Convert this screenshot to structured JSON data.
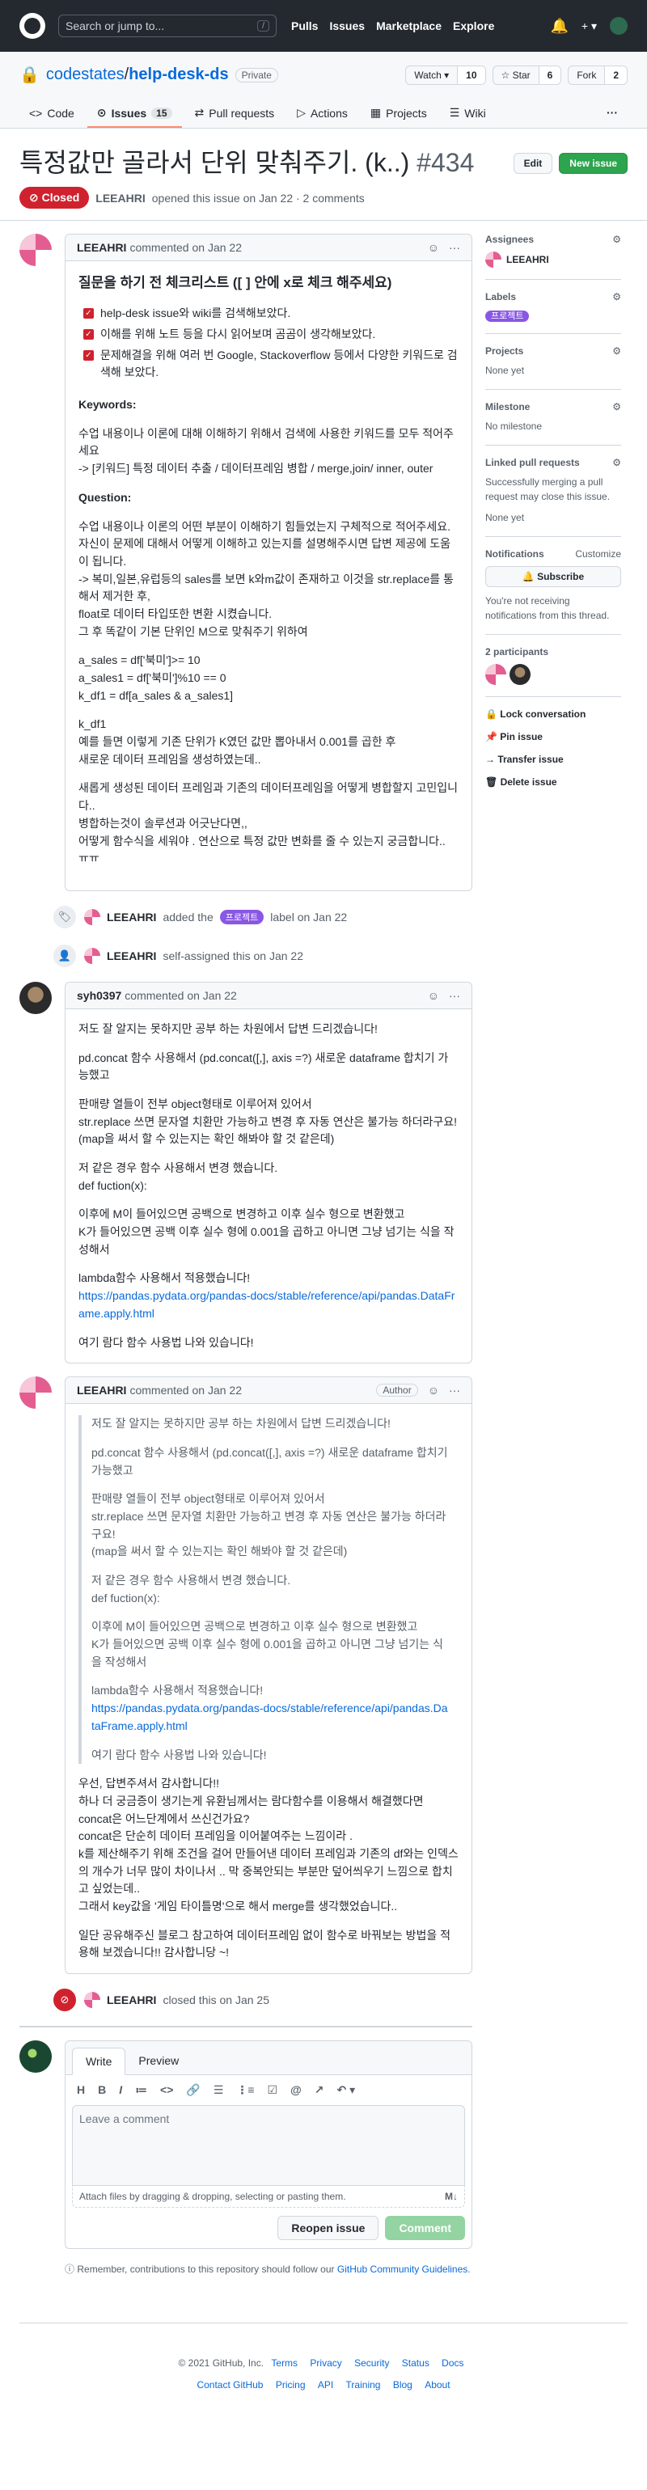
{
  "header": {
    "search_placeholder": "Search or jump to...",
    "search_key": "/",
    "nav": [
      "Pulls",
      "Issues",
      "Marketplace",
      "Explore"
    ],
    "bell": "🔔",
    "plus": "+ ▾"
  },
  "repo": {
    "owner": "codestates",
    "sep": " / ",
    "name": "help-desk-ds",
    "visibility": "Private",
    "watch_label": "Watch ▾",
    "watch_count": "10",
    "star_label": "☆ Star",
    "star_count": "6",
    "fork_label": "Fork",
    "fork_count": "2"
  },
  "tabs": [
    {
      "icon": "<>",
      "label": "Code"
    },
    {
      "icon": "⊙",
      "label": "Issues",
      "count": "15"
    },
    {
      "icon": "⇄",
      "label": "Pull requests"
    },
    {
      "icon": "▷",
      "label": "Actions"
    },
    {
      "icon": "▦",
      "label": "Projects"
    },
    {
      "icon": "☰",
      "label": "Wiki"
    }
  ],
  "tab_more": "···",
  "issue": {
    "title": "특정값만 골라서 단위 맞춰주기. (k..)",
    "number": "#434",
    "edit_label": "Edit",
    "new_label": "New issue",
    "state": "⊘ Closed",
    "author": "LEEAHRI",
    "meta": "opened this issue on Jan 22 · 2 comments"
  },
  "comments": [
    {
      "author": "LEEAHRI",
      "date": "commented on Jan 22",
      "heading": "질문을 하기 전 체크리스트 ([ ] 안에 x로 체크 해주세요)",
      "checks": [
        "help-desk issue와 wiki를 검색해보았다.",
        "이해를 위해 노트 등을 다시 읽어보며 곰곰이 생각해보았다.",
        "문제해결을 위해 여러 번 Google, Stackoverflow 등에서 다양한 키워드로 검색해 보았다."
      ],
      "kw_title": "Keywords:",
      "kw_text": "수업 내용이나 이론에 대해 이해하기 위해서 검색에 사용한 키워드를 모두 적어주세요\n-> [키워드] 특정 데이터 추출 / 데이터프레임 병합 / merge,join/ inner, outer",
      "q_title": "Question:",
      "q_p1": "수업 내용이나 이론의 어떤 부분이 이해하기 힘들었는지 구체적으로 적어주세요. 자신이 문제에 대해서 어떻게 이해하고 있는지를 설명해주시면 답변 제공에 도움이 됩니다.\n-> 복미,일본,유럽등의 sales를 보면 k와m값이 존재하고 이것을 str.replace를 통해서 제거한 후,\nfloat로 데이터 타입또한 변환 시켰습니다.\n그 후 똑같이 기본 단위인 M으로 맞춰주기 위하여",
      "q_p2": "a_sales = df['북미']>= 10\na_sales1 = df['북미']%10 == 0\nk_df1 = df[a_sales & a_sales1]",
      "q_p3": "k_df1\n예를 들면 이렇게 기존 단위가 K였던 값만 뽑아내서 0.001를 곱한 후\n새로운 데이터 프레임을 생성하였는데..",
      "q_p4": "새롭게 생성된 데이터 프레임과 기존의 데이터프레임을 어떻게 병합할지 고민입니다..\n병합하는것이 솔루션과 어긋난다면,,\n어떻게 함수식을 세워야 . 연산으로 특정 값만 변화를 줄 수 있는지 궁금합니다.. ㅠㅠ"
    },
    {
      "author": "syh0397",
      "date": "commented on Jan 22",
      "p1": "저도 잘 알지는 못하지만 공부 하는 차원에서 답변 드리겠습니다!",
      "p2": "pd.concat 함수 사용해서 (pd.concat([,], axis =?) 새로운 dataframe 합치기 가능했고",
      "p3": "판매량 열들이 전부 object형태로 이루어져 있어서\nstr.replace 쓰면 문자열 치환만 가능하고 변경 후 자동 연산은 불가능 하더라구요!\n(map을 써서 할 수 있는지는 확인 해봐야 할 것 같은데)",
      "p4": "저 같은 경우 함수 사용해서 변경 했습니다.\ndef fuction(x):",
      "p5": "이후에 M이 들어있으면 공백으로 변경하고 이후 실수 형으로 변환했고\nK가 들어있으면 공백 이후 실수 형에 0.001을 곱하고 아니면 그냥 넘기는 식을 작성해서",
      "p6": "lambda함수 사용해서 적용했습니다!",
      "link": "https://pandas.pydata.org/pandas-docs/stable/reference/api/pandas.DataFrame.apply.html",
      "p7": "여기 람다 함수 사용법 나와 있습니다!"
    },
    {
      "author": "LEEAHRI",
      "date": "commented on Jan 22",
      "badge": "Author",
      "r1": "우선, 답변주셔서 감사합니다!!\n하나 더 궁금증이 생기는게 유환님께서는 람다함수를 이용해서 해결했다면 concat은 어느단계에서 쓰신건가요?\nconcat은 단순히 데이터 프레임을 이어붙여주는 느낌이라 .\nk를 제산해주기 위해 조건을 걸어 만들어낸 데이터 프레임과 기존의 df와는 인덱스의 개수가 너무 많이 차이나서 .. 막 중복안되는 부분만 덮어씌우기 느낌으로 합치고 싶었는데..\n그래서 key값을 '게임 타이틀명'으로 해서 merge를 생각했었습니다..",
      "r2": "일단 공유해주신 블로그 참고하여 데이터프레임 없이 함수로 바꿔보는 방법을 적용해 보겠습니다!! 감사합니당 ~!"
    }
  ],
  "events": {
    "labeled_user": "LEEAHRI",
    "labeled_pre": "added the",
    "label": "프로젝트",
    "labeled_post": "label on Jan 22",
    "assigned_user": "LEEAHRI",
    "assigned_text": "self-assigned this on Jan 22",
    "closed_user": "LEEAHRI",
    "closed_text": "closed this on Jan 25"
  },
  "editor": {
    "write_tab": "Write",
    "preview_tab": "Preview",
    "toolbar": [
      "H",
      "B",
      "I",
      "≔",
      "<>",
      "🔗",
      "☰",
      "⋮≡",
      "☑",
      "@",
      "↗",
      "↶ ▾"
    ],
    "placeholder": "Leave a comment",
    "attach": "Attach files by dragging & dropping, selecting or pasting them.",
    "md": "M↓",
    "reopen": "Reopen issue",
    "submit": "Comment",
    "note": "Remember, contributions to this repository should follow our",
    "note_link": "GitHub Community Guidelines",
    "note_end": "."
  },
  "sidebar": {
    "assignees_title": "Assignees",
    "assignee": "LEEAHRI",
    "labels_title": "Labels",
    "label": "프로젝트",
    "projects_title": "Projects",
    "projects_value": "None yet",
    "milestone_title": "Milestone",
    "milestone_value": "No milestone",
    "linked_title": "Linked pull requests",
    "linked_desc": "Successfully merging a pull request may close this issue.",
    "linked_value": "None yet",
    "notif_title": "Notifications",
    "notif_customize": "Customize",
    "subscribe": "🔔 Subscribe",
    "notif_desc": "You're not receiving notifications from this thread.",
    "participants": "2 participants",
    "lock": "🔒 Lock conversation",
    "pin": "📌 Pin issue",
    "transfer": "→ Transfer issue",
    "delete": "🗑 Delete issue"
  },
  "footer": {
    "copy": "© 2021 GitHub, Inc.",
    "links1": [
      "Terms",
      "Privacy",
      "Security",
      "Status",
      "Docs"
    ],
    "links2": [
      "Contact GitHub",
      "Pricing",
      "API",
      "Training",
      "Blog",
      "About"
    ]
  }
}
